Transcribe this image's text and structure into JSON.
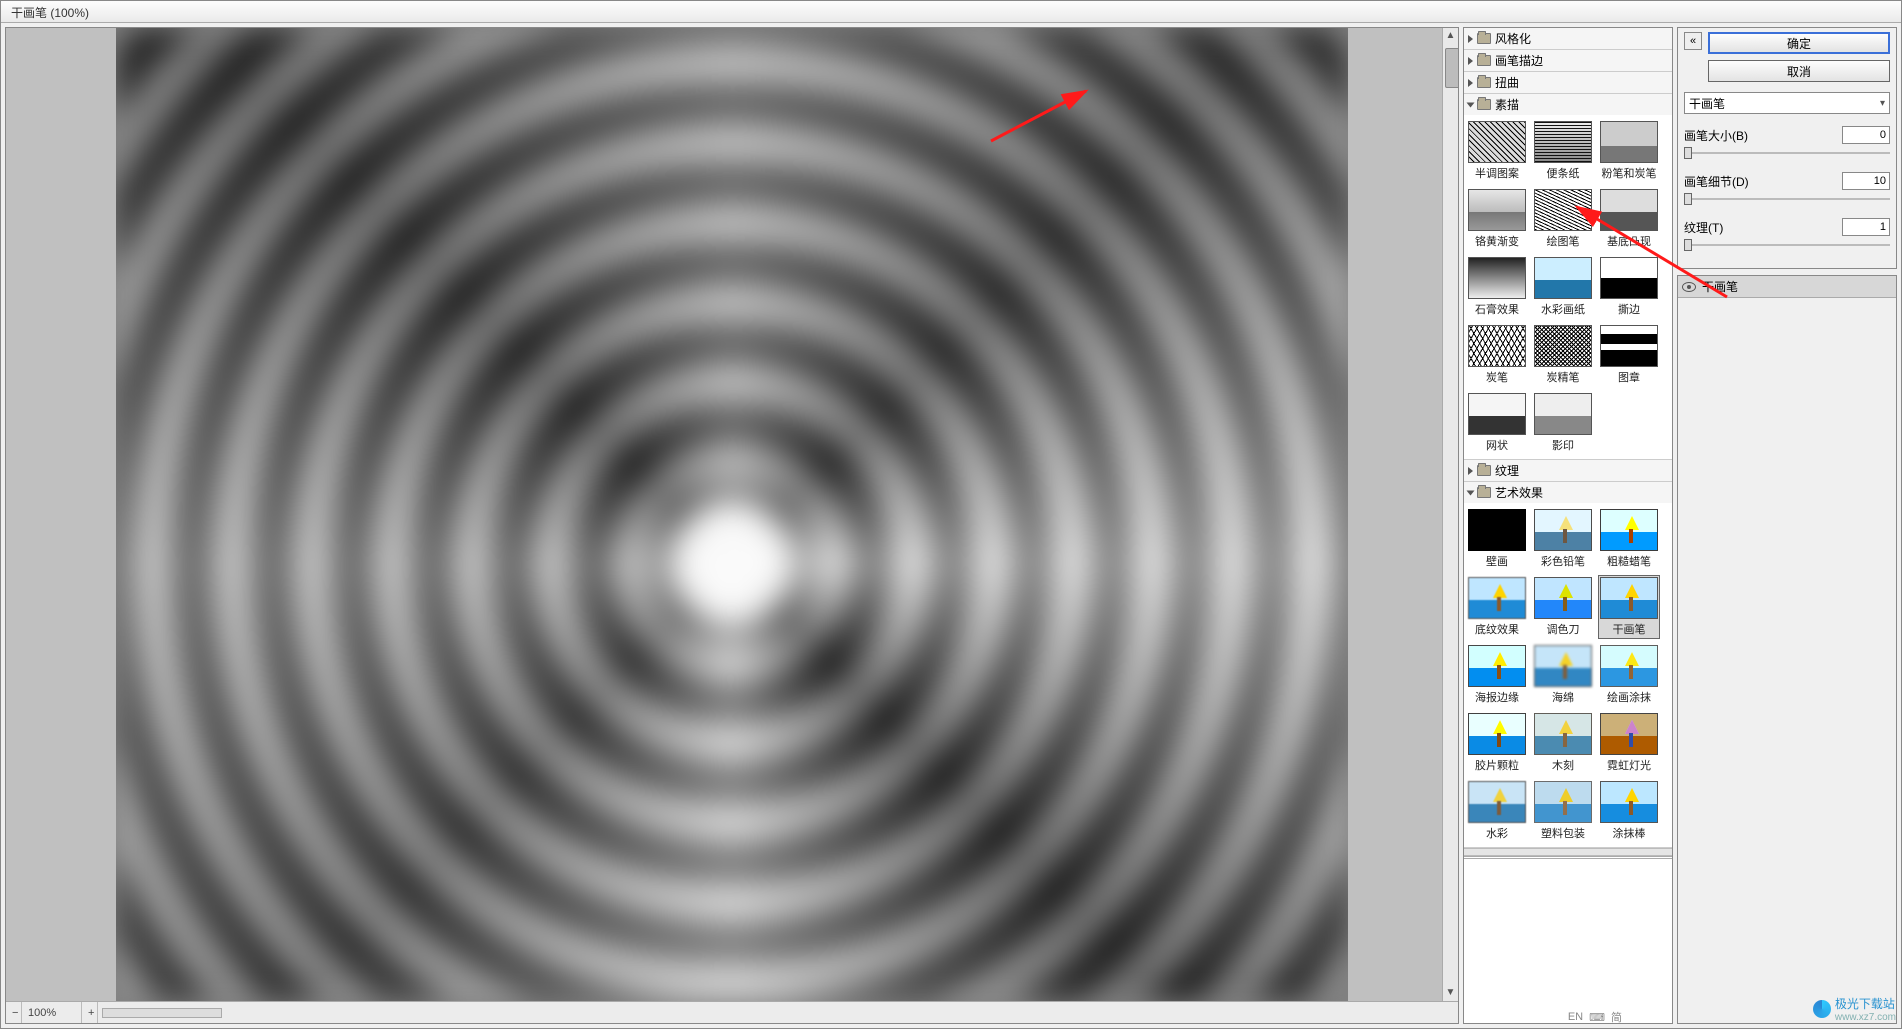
{
  "title": "干画笔 (100%)",
  "statusbar": {
    "minus": "−",
    "zoom": "100%",
    "plus": "+"
  },
  "categories": {
    "stylize": "风格化",
    "brush": "画笔描边",
    "distort": "扭曲",
    "sketch": "素描",
    "texture": "纹理",
    "artistic": "艺术效果"
  },
  "sketch": [
    "半调图案",
    "便条纸",
    "粉笔和炭笔",
    "铬黄渐变",
    "绘图笔",
    "基底凸现",
    "石膏效果",
    "水彩画纸",
    "撕边",
    "炭笔",
    "炭精笔",
    "图章",
    "网状",
    "影印"
  ],
  "artistic": [
    "壁画",
    "彩色铅笔",
    "粗糙蜡笔",
    "底纹效果",
    "调色刀",
    "干画笔",
    "海报边缘",
    "海绵",
    "绘画涂抹",
    "胶片颗粒",
    "木刻",
    "霓虹灯光",
    "水彩",
    "塑料包装",
    "涂抹棒"
  ],
  "selected_artistic_index": 5,
  "controls": {
    "ok": "确定",
    "cancel": "取消",
    "filter_name": "干画笔",
    "params": [
      {
        "label": "画笔大小(B)",
        "value": "0"
      },
      {
        "label": "画笔细节(D)",
        "value": "10"
      },
      {
        "label": "纹理(T)",
        "value": "1"
      }
    ]
  },
  "effects_layer": "干画笔",
  "watermark": {
    "brand": "极光下载站",
    "url": "www.xz7.com"
  },
  "ime": {
    "lang": "EN",
    "icon": "简"
  }
}
